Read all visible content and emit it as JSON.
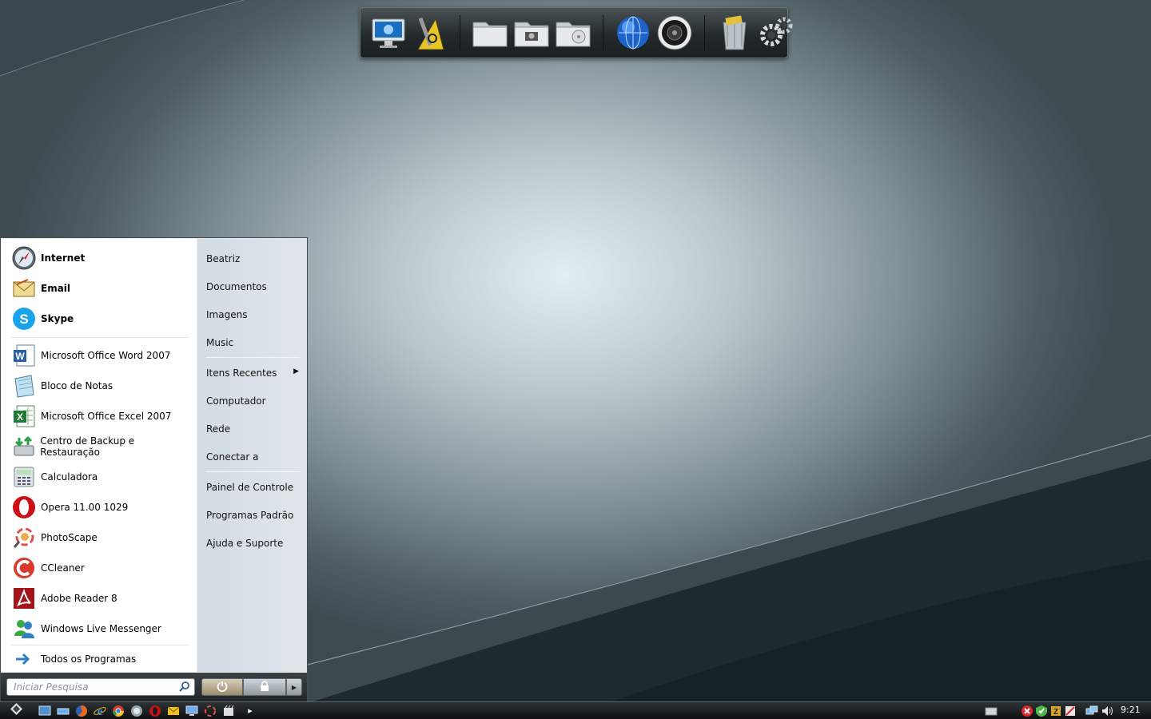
{
  "dock": {
    "items": [
      {
        "name": "computer-icon"
      },
      {
        "name": "tools-icon"
      },
      {
        "name": "folder-icon"
      },
      {
        "name": "pictures-folder-icon"
      },
      {
        "name": "music-folder-icon"
      },
      {
        "name": "globe-icon"
      },
      {
        "name": "speaker-icon"
      },
      {
        "name": "trash-icon"
      },
      {
        "name": "gears-icon"
      }
    ]
  },
  "start_menu": {
    "pinned": [
      {
        "label": "Internet"
      },
      {
        "label": "Email"
      },
      {
        "label": "Skype"
      }
    ],
    "recent": [
      {
        "label": "Microsoft Office Word 2007"
      },
      {
        "label": "Bloco de Notas"
      },
      {
        "label": "Microsoft Office Excel 2007"
      },
      {
        "label": "Centro de Backup e Restauração"
      },
      {
        "label": "Calculadora"
      },
      {
        "label": "Opera 11.00 1029"
      },
      {
        "label": "PhotoScape"
      },
      {
        "label": "CCleaner"
      },
      {
        "label": "Adobe Reader 8"
      },
      {
        "label": "Windows Live Messenger"
      }
    ],
    "all_programs": "Todos os Programas",
    "right": {
      "user": "Beatriz",
      "documents": "Documentos",
      "images": "Imagens",
      "music": "Music",
      "recent_items": "Itens Recentes",
      "computer": "Computador",
      "network": "Rede",
      "connect": "Conectar a",
      "control_panel": "Painel de Controle",
      "default_programs": "Programas Padrão",
      "help": "Ajuda e Suporte"
    },
    "search_placeholder": "Iniciar Pesquisa"
  },
  "taskbar": {
    "clock": "9:21"
  },
  "colors": {
    "accent": "#2f7fc4",
    "opera_red": "#cc0f16"
  }
}
